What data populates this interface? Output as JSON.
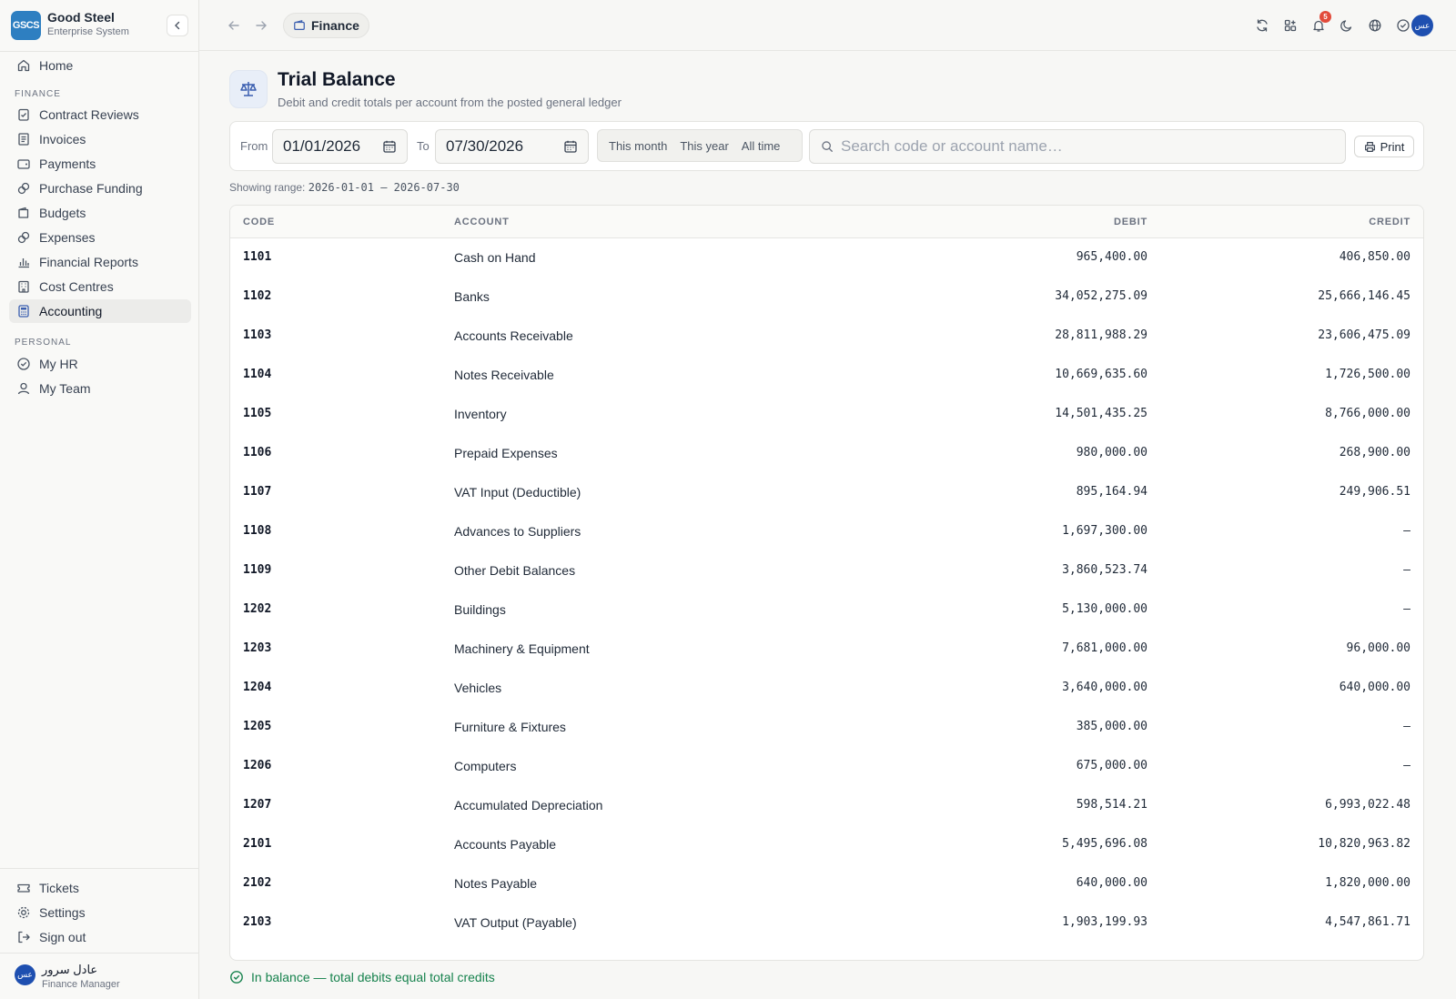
{
  "brand": {
    "logo_text": "GSCS",
    "name": "Good Steel",
    "subtitle": "Enterprise System"
  },
  "sidebar": {
    "home": "Home",
    "finance_section": "FINANCE",
    "finance_items": [
      {
        "label": "Contract Reviews",
        "icon": "clipboard-check-icon"
      },
      {
        "label": "Invoices",
        "icon": "receipt-icon"
      },
      {
        "label": "Payments",
        "icon": "wallet-icon"
      },
      {
        "label": "Purchase Funding",
        "icon": "coins-icon"
      },
      {
        "label": "Budgets",
        "icon": "wallet-icon"
      },
      {
        "label": "Expenses",
        "icon": "coins-icon"
      },
      {
        "label": "Financial Reports",
        "icon": "bar-chart-icon"
      },
      {
        "label": "Cost Centres",
        "icon": "building-icon"
      },
      {
        "label": "Accounting",
        "icon": "calculator-icon",
        "active": true
      }
    ],
    "personal_section": "PERSONAL",
    "personal_items": [
      {
        "label": "My HR",
        "icon": "check-circle-icon"
      },
      {
        "label": "My Team",
        "icon": "user-icon"
      }
    ],
    "bottom_items": [
      {
        "label": "Tickets",
        "icon": "ticket-icon"
      },
      {
        "label": "Settings",
        "icon": "gear-icon"
      },
      {
        "label": "Sign out",
        "icon": "logout-icon"
      }
    ],
    "user": {
      "avatar": "عس",
      "name": "عادل سرور",
      "role": "Finance Manager"
    }
  },
  "topbar": {
    "breadcrumb": "Finance",
    "notification_count": "5",
    "avatar": "عس"
  },
  "page": {
    "title": "Trial Balance",
    "subtitle": "Debit and credit totals per account from the posted general ledger"
  },
  "filters": {
    "from_label": "From",
    "from_value": "01/01/2026",
    "to_label": "To",
    "to_value": "07/30/2026",
    "presets": [
      "This month",
      "This year",
      "All time"
    ],
    "search_placeholder": "Search code or account name…",
    "print_label": "Print",
    "range_label": "Showing range:",
    "range_value": "2026-01-01 — 2026-07-30"
  },
  "table": {
    "headers": {
      "code": "CODE",
      "account": "ACCOUNT",
      "debit": "DEBIT",
      "credit": "CREDIT"
    },
    "rows": [
      {
        "code": "1101",
        "account": "Cash on Hand",
        "debit": "965,400.00",
        "credit": "406,850.00"
      },
      {
        "code": "1102",
        "account": "Banks",
        "debit": "34,052,275.09",
        "credit": "25,666,146.45"
      },
      {
        "code": "1103",
        "account": "Accounts Receivable",
        "debit": "28,811,988.29",
        "credit": "23,606,475.09"
      },
      {
        "code": "1104",
        "account": "Notes Receivable",
        "debit": "10,669,635.60",
        "credit": "1,726,500.00"
      },
      {
        "code": "1105",
        "account": "Inventory",
        "debit": "14,501,435.25",
        "credit": "8,766,000.00"
      },
      {
        "code": "1106",
        "account": "Prepaid Expenses",
        "debit": "980,000.00",
        "credit": "268,900.00"
      },
      {
        "code": "1107",
        "account": "VAT Input (Deductible)",
        "debit": "895,164.94",
        "credit": "249,906.51"
      },
      {
        "code": "1108",
        "account": "Advances to Suppliers",
        "debit": "1,697,300.00",
        "credit": "—"
      },
      {
        "code": "1109",
        "account": "Other Debit Balances",
        "debit": "3,860,523.74",
        "credit": "—"
      },
      {
        "code": "1202",
        "account": "Buildings",
        "debit": "5,130,000.00",
        "credit": "—"
      },
      {
        "code": "1203",
        "account": "Machinery & Equipment",
        "debit": "7,681,000.00",
        "credit": "96,000.00"
      },
      {
        "code": "1204",
        "account": "Vehicles",
        "debit": "3,640,000.00",
        "credit": "640,000.00"
      },
      {
        "code": "1205",
        "account": "Furniture & Fixtures",
        "debit": "385,000.00",
        "credit": "—"
      },
      {
        "code": "1206",
        "account": "Computers",
        "debit": "675,000.00",
        "credit": "—"
      },
      {
        "code": "1207",
        "account": "Accumulated Depreciation",
        "debit": "598,514.21",
        "credit": "6,993,022.48"
      },
      {
        "code": "2101",
        "account": "Accounts Payable",
        "debit": "5,495,696.08",
        "credit": "10,820,963.82"
      },
      {
        "code": "2102",
        "account": "Notes Payable",
        "debit": "640,000.00",
        "credit": "1,820,000.00"
      },
      {
        "code": "2103",
        "account": "VAT Output (Payable)",
        "debit": "1,903,199.93",
        "credit": "4,547,861.71"
      }
    ]
  },
  "status": {
    "text": "In balance — total debits equal total credits",
    "color": "#16824d"
  },
  "colors": {
    "brand": "#2e7fc1",
    "avatar": "#1e4fb0",
    "badge": "#e24b3b"
  }
}
